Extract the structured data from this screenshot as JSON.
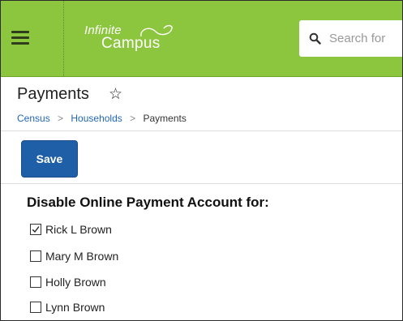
{
  "header": {
    "menu_icon": "hamburger-menu-icon",
    "logo_line1": "Infinite",
    "logo_line2": "Campus",
    "search_icon": "search-icon",
    "search_placeholder": "Search for"
  },
  "page": {
    "title": "Payments",
    "favorite_icon": "star-outline-icon"
  },
  "breadcrumb": {
    "items": [
      "Census",
      "Households",
      "Payments"
    ],
    "separator": ">"
  },
  "toolbar": {
    "save_label": "Save"
  },
  "section": {
    "heading": "Disable Online Payment Account for:",
    "people": [
      {
        "name": "Rick L Brown",
        "checked": true
      },
      {
        "name": "Mary M Brown",
        "checked": false
      },
      {
        "name": "Holly Brown",
        "checked": false
      },
      {
        "name": "Lynn Brown",
        "checked": false
      }
    ]
  },
  "colors": {
    "header_green": "#8cc63f",
    "save_blue": "#1f5fa8",
    "link_blue": "#1f66b8"
  }
}
